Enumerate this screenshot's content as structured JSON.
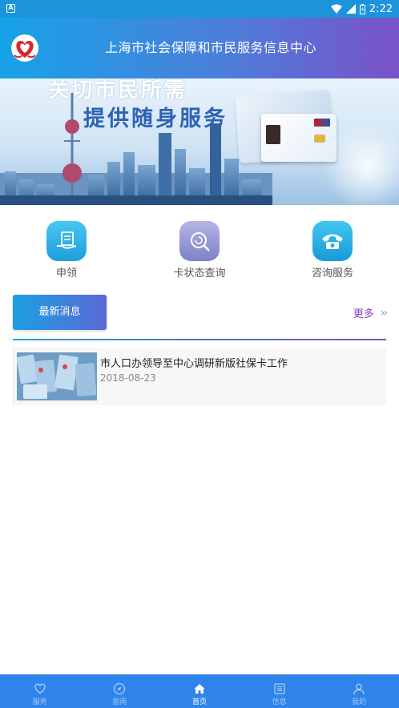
{
  "status_bar": {
    "time": "2:22",
    "notification_icon": "a-box-icon"
  },
  "header": {
    "title": "上海市社会保障和市民服务信息中心",
    "logo": "shanghai-social-security-logo"
  },
  "banner": {
    "slogan_line1": "关切市民所需",
    "slogan_line2": "提供随身服务"
  },
  "quick_actions": [
    {
      "label": "申领",
      "icon": "apply-card-icon"
    },
    {
      "label": "卡状态查询",
      "icon": "card-status-search-icon"
    },
    {
      "label": "咨询服务",
      "icon": "phone-consult-icon"
    }
  ],
  "news": {
    "tab_label": "最新消息",
    "more_label": "更多",
    "more_icon": "double-chevron-right-icon",
    "items": [
      {
        "title": "市人口办领导至中心调研新版社保卡工作",
        "date": "2018-08-23"
      }
    ]
  },
  "tab_bar": {
    "items": [
      {
        "label": "服务",
        "icon": "heart-icon",
        "active": false
      },
      {
        "label": "指南",
        "icon": "compass-icon",
        "active": false
      },
      {
        "label": "首页",
        "icon": "home-icon",
        "active": true
      },
      {
        "label": "信息",
        "icon": "list-icon",
        "active": false
      },
      {
        "label": "我的",
        "icon": "user-icon",
        "active": false
      }
    ]
  },
  "colors": {
    "header_start": "#16a3e6",
    "header_end": "#7a52c9",
    "tab_bar": "#2f84eb",
    "more_text": "#8a3fc1"
  }
}
